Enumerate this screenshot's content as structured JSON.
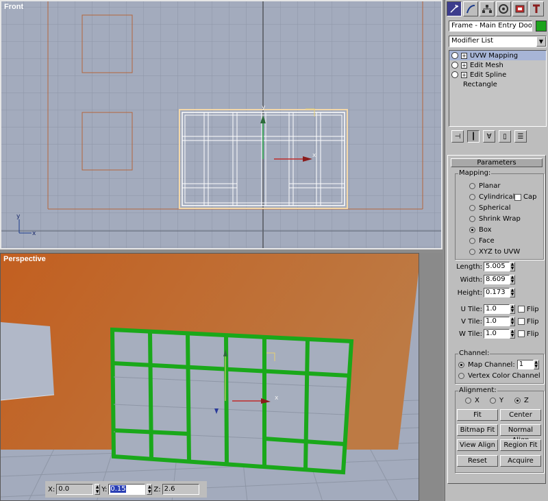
{
  "viewports": {
    "front_label": "Front",
    "perspective_label": "Perspective",
    "axis_x": "x",
    "axis_y": "y"
  },
  "panel": {
    "object_name": "Frame - Main Entry Doors",
    "object_color": "#1ca31c",
    "modifier_list": "Modifier List",
    "stack": [
      {
        "label": "UVW Mapping",
        "selected": true
      },
      {
        "label": "Edit Mesh",
        "selected": false
      },
      {
        "label": "Edit Spline",
        "selected": false
      },
      {
        "label": "Rectangle",
        "selected": false
      }
    ],
    "rollout_title": "Parameters",
    "mapping": {
      "title": "Mapping:",
      "options": [
        "Planar",
        "Cylindrical",
        "Spherical",
        "Shrink Wrap",
        "Box",
        "Face",
        "XYZ to UVW"
      ],
      "selected": "Box",
      "cap_label": "Cap"
    },
    "dims": {
      "length_label": "Length:",
      "length": "5.005",
      "width_label": "Width:",
      "width": "8.609",
      "height_label": "Height:",
      "height": "0.173"
    },
    "tiles": {
      "u_label": "U Tile:",
      "u": "1.0",
      "v_label": "V Tile:",
      "v": "1.0",
      "w_label": "W Tile:",
      "w": "1.0",
      "flip_label": "Flip"
    },
    "channel": {
      "title": "Channel:",
      "map_channel_label": "Map Channel:",
      "map_channel_value": "1",
      "vertex_color_label": "Vertex Color Channel"
    },
    "alignment": {
      "title": "Alignment:",
      "x": "X",
      "y": "Y",
      "z": "Z",
      "selected": "Z",
      "fit": "Fit",
      "center": "Center",
      "bitmap_fit": "Bitmap Fit",
      "normal_align": "Normal Align",
      "view_align": "View Align",
      "region_fit": "Region Fit",
      "reset": "Reset",
      "acquire": "Acquire"
    }
  },
  "coords": {
    "x_label": "X:",
    "x": "0.0",
    "y_label": "Y:",
    "y": "0.15",
    "z_label": "Z:",
    "z": "2.6"
  },
  "colors": {
    "viewport_bg": "#a3abbd",
    "wall": "#c4692a",
    "frame_green": "#1aa81a",
    "selection_blue": "#2a3fb4"
  }
}
